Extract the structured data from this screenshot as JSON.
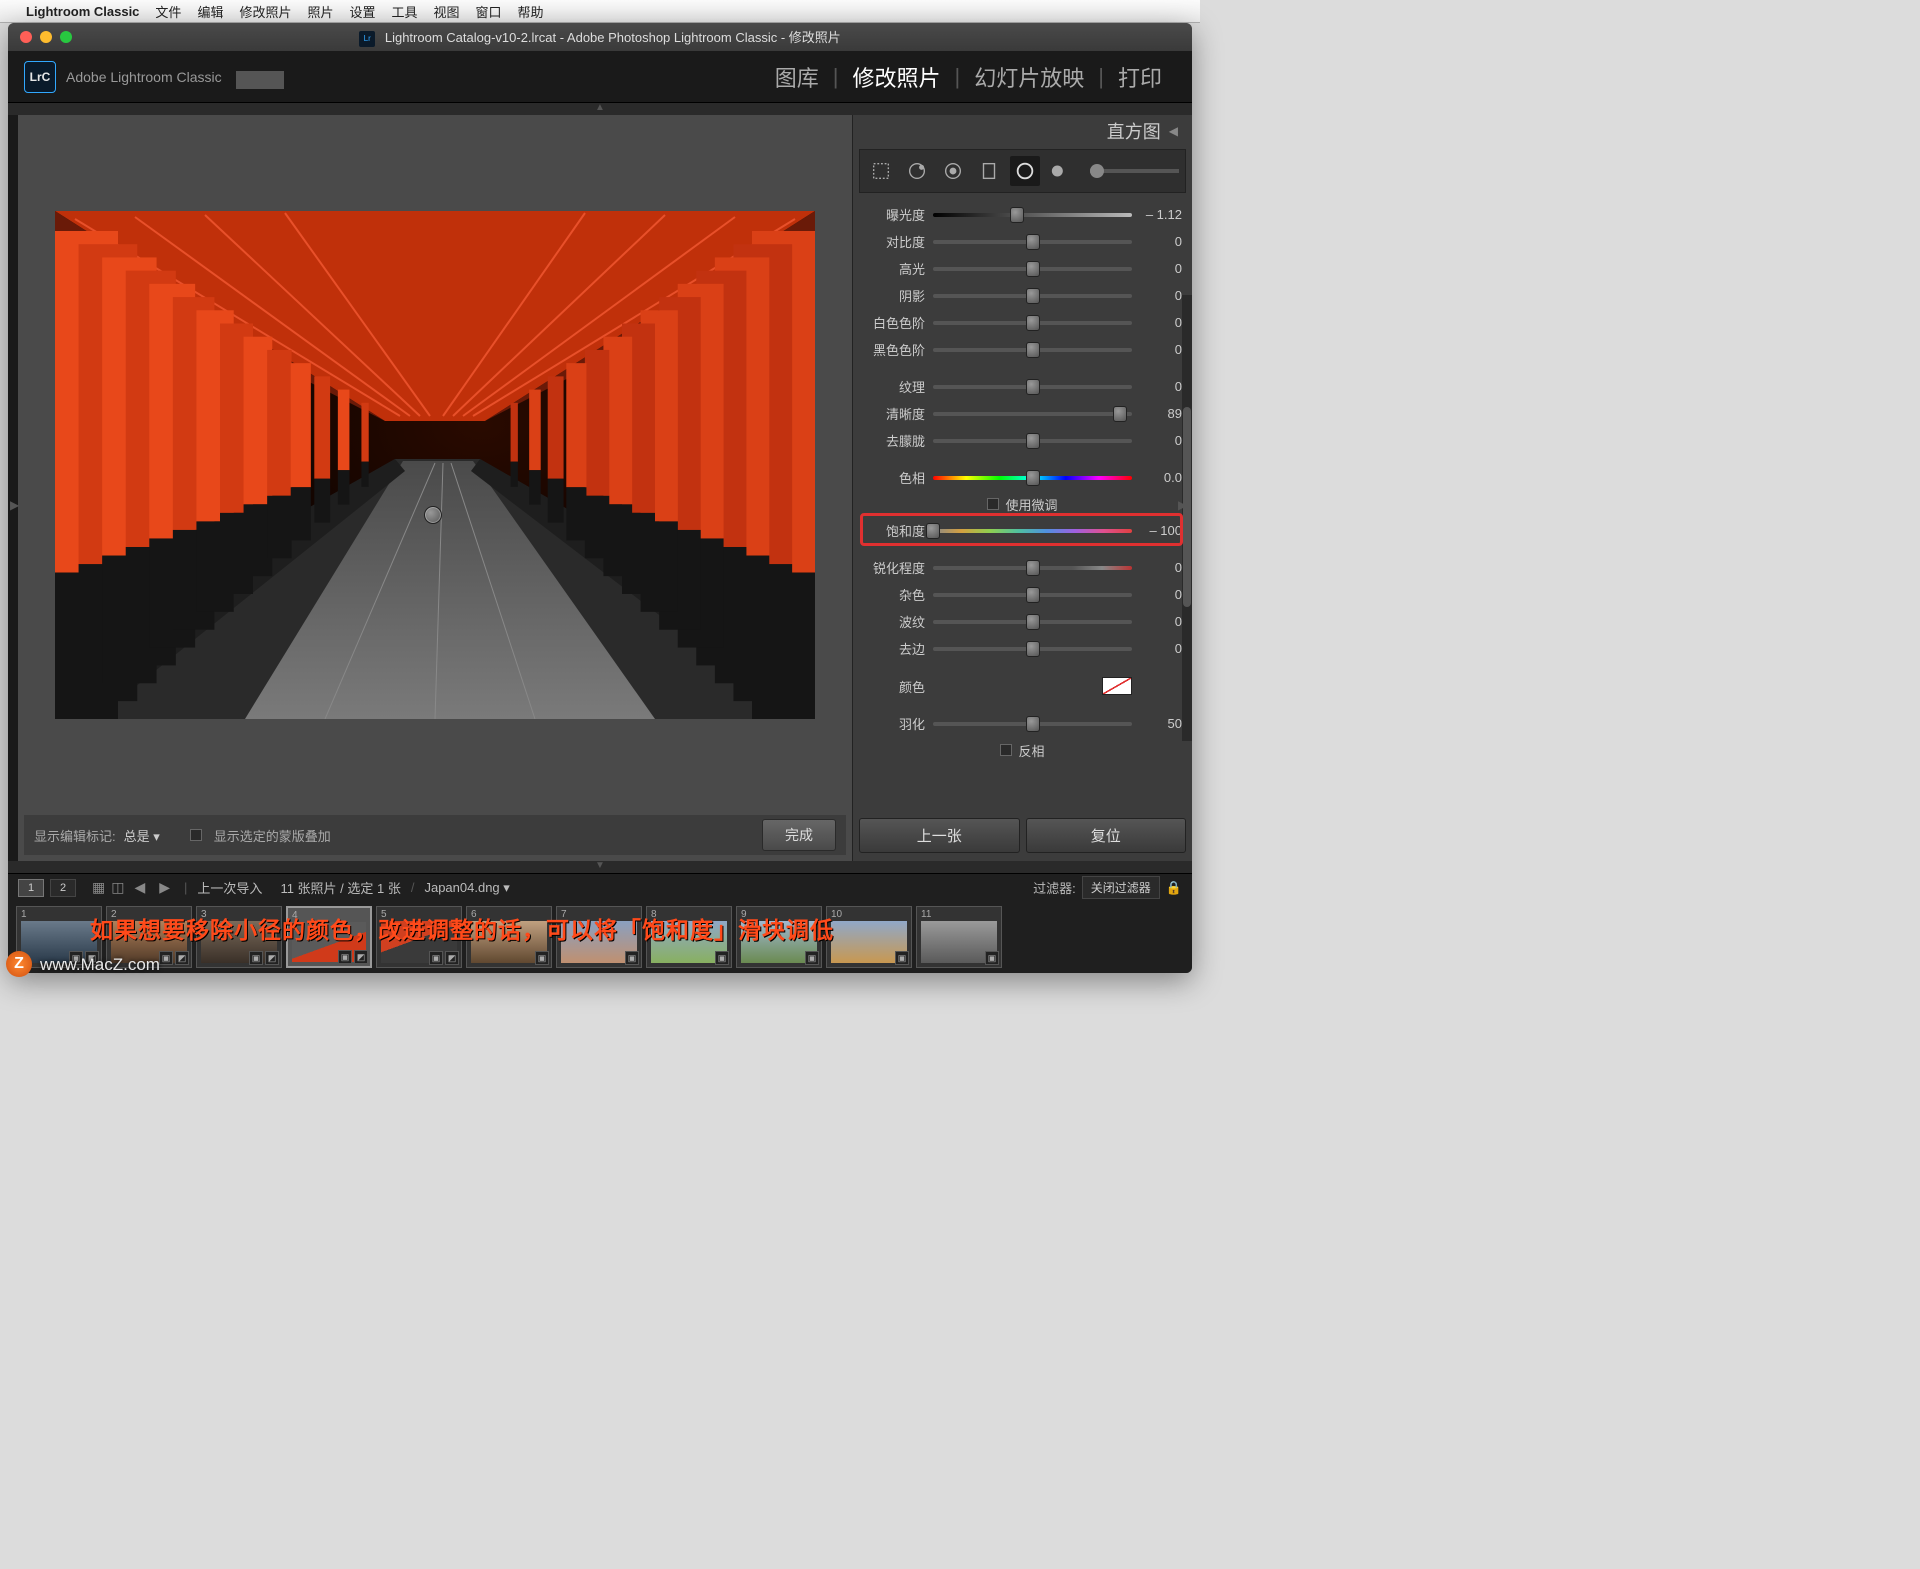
{
  "menubar": {
    "app": "Lightroom Classic",
    "items": [
      "文件",
      "编辑",
      "修改照片",
      "照片",
      "设置",
      "工具",
      "视图",
      "窗口",
      "帮助"
    ]
  },
  "window": {
    "title": "Lightroom Catalog-v10-2.lrcat - Adobe Photoshop Lightroom Classic - 修改照片"
  },
  "brand": {
    "logo": "LrC",
    "label": "Adobe Lightroom Classic"
  },
  "modules": [
    "图库",
    "修改照片",
    "幻灯片放映",
    "打印"
  ],
  "modules_active_index": 1,
  "panel_header": "直方图",
  "sliders": [
    {
      "label": "曝光度",
      "value": "– 1.12",
      "pos": 42,
      "track": "grad1"
    },
    {
      "label": "对比度",
      "value": "0",
      "pos": 50
    },
    {
      "label": "高光",
      "value": "0",
      "pos": 50
    },
    {
      "label": "阴影",
      "value": "0",
      "pos": 50
    },
    {
      "label": "白色色阶",
      "value": "0",
      "pos": 50
    },
    {
      "label": "黑色色阶",
      "value": "0",
      "pos": 50
    },
    {
      "sep": true
    },
    {
      "label": "纹理",
      "value": "0",
      "pos": 50
    },
    {
      "label": "清晰度",
      "value": "89",
      "pos": 94
    },
    {
      "label": "去朦胧",
      "value": "0",
      "pos": 50
    },
    {
      "sep": true
    },
    {
      "label": "色相",
      "value": "0.0",
      "pos": 50,
      "track": "hue"
    },
    {
      "check": true,
      "label": "使用微调"
    },
    {
      "label": "饱和度",
      "value": "– 100",
      "pos": 0,
      "track": "sat",
      "highlight": true
    },
    {
      "sep": true
    },
    {
      "label": "锐化程度",
      "value": "0",
      "pos": 50,
      "track": "sharp"
    },
    {
      "label": "杂色",
      "value": "0",
      "pos": 50
    },
    {
      "label": "波纹",
      "value": "0",
      "pos": 50
    },
    {
      "label": "去边",
      "value": "0",
      "pos": 50
    },
    {
      "sep": true
    },
    {
      "swatch": true,
      "label": "颜色"
    },
    {
      "sep": true
    },
    {
      "label": "羽化",
      "value": "50",
      "pos": 50
    },
    {
      "check": true,
      "label": "反相"
    }
  ],
  "photobar": {
    "label": "显示编辑标记:",
    "dropdown": "总是",
    "option": "显示选定的蒙版叠加",
    "done": "完成"
  },
  "rp_buttons": {
    "prev": "上一张",
    "reset": "复位"
  },
  "filmstrip_top": {
    "nav": [
      "1",
      "2"
    ],
    "nav_active": 0,
    "import_label": "上一次导入",
    "count_label": "11 张照片 / 选定 1 张",
    "filename": "Japan04.dng",
    "filter_label": "过滤器:",
    "filter_value": "关闭过滤器"
  },
  "thumbs": [
    1,
    2,
    3,
    4,
    5,
    6,
    7,
    8,
    9,
    10,
    11
  ],
  "selected_thumb": 4,
  "overlay_caption": "如果想要移除小径的颜色，改进调整的话，可以将「饱和度」滑块调低",
  "watermark": "www.MacZ.com",
  "watermark_icon": "Z"
}
